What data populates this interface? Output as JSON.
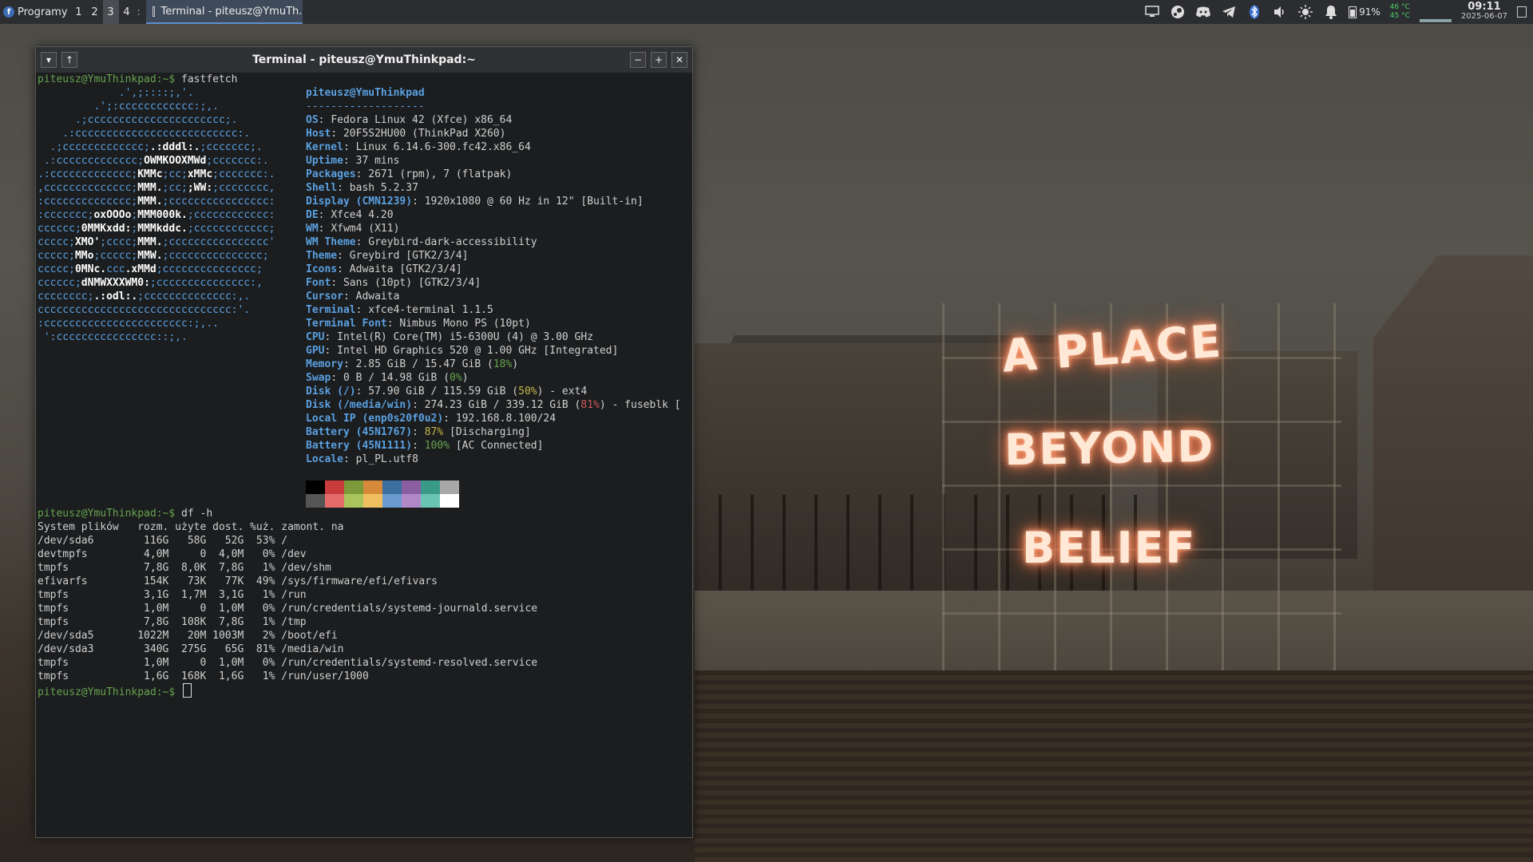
{
  "panel": {
    "apps_menu_label": "Programy",
    "workspaces": [
      "1",
      "2",
      "3",
      "4"
    ],
    "active_workspace": "3",
    "workspace_sep": ":",
    "taskbar_item": "Terminal - piteusz@YmuTh...",
    "battery_percent": "91%",
    "temp_1": "46 °C",
    "temp_2": "45 °C",
    "clock_time": "09:11",
    "clock_date": "2025-06-07",
    "tray_icons": [
      "display-icon",
      "steam-icon",
      "discord-icon",
      "telegram-icon",
      "bluetooth-icon",
      "volume-icon",
      "brightness-icon",
      "bell-icon",
      "battery-icon"
    ]
  },
  "window": {
    "title": "Terminal - piteusz@YmuThinkpad:~",
    "prompt": "piteusz@YmuThinkpad:~$ ",
    "cmd_1": "fastfetch",
    "cmd_2": "df -h"
  },
  "fastfetch": {
    "user_host": "piteusz@YmuThinkpad",
    "separator": "-------------------",
    "rows": [
      {
        "k": "OS",
        "v": "Fedora Linux 42 (Xfce) x86_64"
      },
      {
        "k": "Host",
        "v": "20F5S2HU00 (ThinkPad X260)"
      },
      {
        "k": "Kernel",
        "v": "Linux 6.14.6-300.fc42.x86_64"
      },
      {
        "k": "Uptime",
        "v": "37 mins"
      },
      {
        "k": "Packages",
        "v": "2671 (rpm), 7 (flatpak)"
      },
      {
        "k": "Shell",
        "v": "bash 5.2.37"
      },
      {
        "k": "Display (CMN1239)",
        "v": "1920x1080 @ 60 Hz in 12\" [Built-in]"
      },
      {
        "k": "DE",
        "v": "Xfce4 4.20"
      },
      {
        "k": "WM",
        "v": "Xfwm4 (X11)"
      },
      {
        "k": "WM Theme",
        "v": "Greybird-dark-accessibility"
      },
      {
        "k": "Theme",
        "v": "Greybird [GTK2/3/4]"
      },
      {
        "k": "Icons",
        "v": "Adwaita [GTK2/3/4]"
      },
      {
        "k": "Font",
        "v": "Sans (10pt) [GTK2/3/4]"
      },
      {
        "k": "Cursor",
        "v": "Adwaita"
      },
      {
        "k": "Terminal",
        "v": "xfce4-terminal 1.1.5"
      },
      {
        "k": "Terminal Font",
        "v": "Nimbus Mono PS (10pt)"
      },
      {
        "k": "CPU",
        "v": "Intel(R) Core(TM) i5-6300U (4) @ 3.00 GHz"
      },
      {
        "k": "GPU",
        "v": "Intel HD Graphics 520 @ 1.00 GHz [Integrated]"
      }
    ],
    "memory": {
      "k": "Memory",
      "v": "2.85 GiB / 15.47 GiB (",
      "pct": "18%",
      "end": ")",
      "cls": "green"
    },
    "swap": {
      "k": "Swap",
      "v": "0 B / 14.98 GiB (",
      "pct": "0%",
      "end": ")",
      "cls": "green"
    },
    "disk_root": {
      "k": "Disk (/)",
      "v": "57.90 GiB / 115.59 GiB (",
      "pct": "50%",
      "end": ") - ext4",
      "cls": "yellow"
    },
    "disk_win": {
      "k": "Disk (/media/win)",
      "v": "274.23 GiB / 339.12 GiB (",
      "pct": "81%",
      "end": ") - fuseblk [",
      "cls": "red"
    },
    "local_ip": {
      "k": "Local IP (enp0s20f0u2)",
      "v": "192.168.8.100/24"
    },
    "battery_1": {
      "k": "Battery (45N1767)",
      "pct": "87%",
      "end": " [Discharging]",
      "cls": "yellow"
    },
    "battery_2": {
      "k": "Battery (45N1111)",
      "pct": "100%",
      "end": " [AC Connected]",
      "cls": "green"
    },
    "locale": {
      "k": "Locale",
      "v": "pl_PL.utf8"
    },
    "palette_top": [
      "#000000",
      "#c83c3c",
      "#7d9a3a",
      "#d68a3a",
      "#3a6fa0",
      "#8a5ea0",
      "#3a9a8a",
      "#a8a8a8"
    ],
    "palette_bottom": [
      "#555555",
      "#e56a6a",
      "#a8c45a",
      "#f0c060",
      "#6a9ad0",
      "#b088c8",
      "#6ac4b4",
      "#ffffff"
    ],
    "logo_lines": [
      [
        "             .',;::::;,'.",
        ""
      ],
      [
        "         .';:cccccccccccc:;,.",
        ""
      ],
      [
        "      .;cccccccccccccccccccccc;.",
        ""
      ],
      [
        "    .:cccccccccccccccccccccccccc:.",
        ""
      ],
      [
        "  .;ccccccccccccc;",
        ".:dddl:.",
        ";ccccccc;."
      ],
      [
        " .:ccccccccccccc;",
        "OWMKOOXMWd",
        ";ccccccc:."
      ],
      [
        ".:ccccccccccccc;",
        "KMMc",
        ";cc;",
        "xMMc",
        ";ccccccc:."
      ],
      [
        ",cccccccccccccc;",
        "MMM.",
        ";cc;",
        ";WW:",
        ";cccccccc,"
      ],
      [
        ":cccccccccccccc;",
        "MMM.",
        ";cccccccccccccccc:"
      ],
      [
        ":ccccccc;",
        "oxOOOo",
        ";",
        "MMM000k.",
        ";cccccccccccc:"
      ],
      [
        "cccccc;",
        "0MMKxdd:",
        ";",
        "MMMkddc.",
        ";cccccccccccc;"
      ],
      [
        "ccccc;",
        "XMO'",
        ";cccc;",
        "MMM.",
        ";cccccccccccccccc'"
      ],
      [
        "ccccc;",
        "MMo",
        ";ccccc;",
        "MMW.",
        ";ccccccccccccccc;"
      ],
      [
        "ccccc;",
        "0MNc.",
        "ccc",
        ".xMMd",
        ";ccccccccccccccc;"
      ],
      [
        "cccccc;",
        "dNMWXXXWM0:",
        ";ccccccccccccccc:,"
      ],
      [
        "cccccccc;",
        ".:odl:.",
        ";cccccccccccccc:,."
      ],
      [
        "ccccccccccccccccccccccccccccccc:'.",
        ""
      ],
      [
        ":ccccccccccccccccccccccc:;,..",
        ""
      ],
      [
        " ':cccccccccccccccc::;,.",
        ""
      ]
    ]
  },
  "df": {
    "header": "System plików   rozm. użyte dost. %uż. zamont. na",
    "rows": [
      "/dev/sda6        116G   58G   52G  53% /",
      "devtmpfs         4,0M     0  4,0M   0% /dev",
      "tmpfs            7,8G  8,0K  7,8G   1% /dev/shm",
      "efivarfs         154K   73K   77K  49% /sys/firmware/efi/efivars",
      "tmpfs            3,1G  1,7M  3,1G   1% /run",
      "tmpfs            1,0M     0  1,0M   0% /run/credentials/systemd-journald.service",
      "tmpfs            7,8G  108K  7,8G   1% /tmp",
      "/dev/sda5       1022M   20M 1003M   2% /boot/efi",
      "/dev/sda3        340G  275G   65G  81% /media/win",
      "tmpfs            1,0M     0  1,0M   0% /run/credentials/systemd-resolved.service",
      "tmpfs            1,6G  168K  1,6G   1% /run/user/1000"
    ]
  },
  "wallpaper": {
    "neon_line_1": "A PLACE",
    "neon_line_2": "BEYOND",
    "neon_line_3": "BELIEF"
  }
}
